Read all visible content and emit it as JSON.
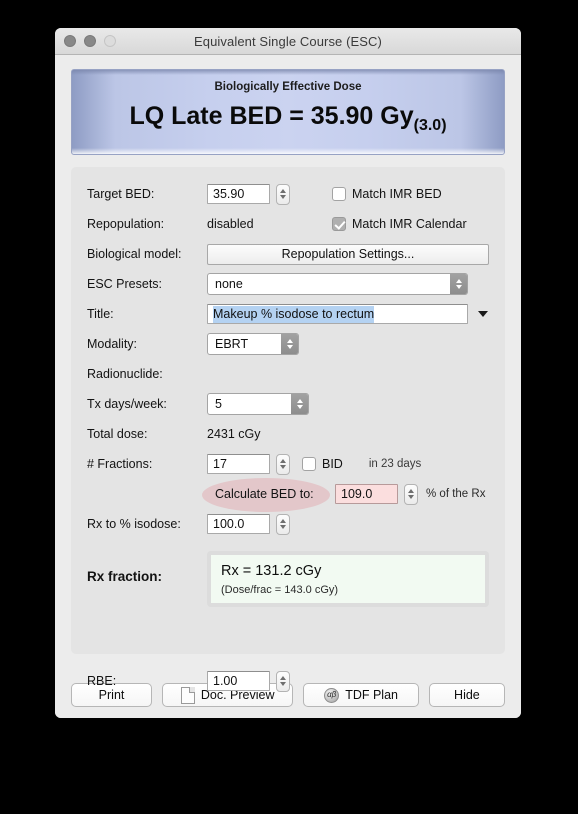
{
  "window": {
    "title": "Equivalent Single Course (ESC)",
    "traffic_lights": [
      "close-button",
      "minimize-button",
      "zoom-button"
    ]
  },
  "banner": {
    "subtitle": "Biologically Effective Dose",
    "main": "LQ Late BED = 35.90 Gy",
    "main_subscript": "(3.0)"
  },
  "form": {
    "target_bed": {
      "label": "Target BED:",
      "value": "35.90"
    },
    "match_imr_bed": {
      "label": "Match IMR BED",
      "checked": false
    },
    "repopulation": {
      "label": "Repopulation:",
      "value": "disabled"
    },
    "match_imr_calendar": {
      "label": "Match IMR Calendar",
      "checked": true
    },
    "biological_model": {
      "label": "Biological model:",
      "button": "Repopulation Settings..."
    },
    "esc_presets": {
      "label": "ESC Presets:",
      "value": "none"
    },
    "title": {
      "label": "Title:",
      "value": "Makeup % isodose to rectum"
    },
    "modality": {
      "label": "Modality:",
      "value": "EBRT"
    },
    "radionuclide": {
      "label": "Radionuclide:",
      "value": ""
    },
    "tx_days_week": {
      "label": "Tx days/week:",
      "value": "5"
    },
    "total_dose": {
      "label": "Total dose:",
      "value": "2431 cGy"
    },
    "fractions": {
      "label": "# Fractions:",
      "value": "17"
    },
    "bid": {
      "label": "BID",
      "checked": false
    },
    "in_days": "in 23 days",
    "calculate_bed_to": {
      "label": "Calculate BED to:",
      "value": "109.0",
      "unit": "% of the Rx",
      "highlighted": true
    },
    "rx_to_isodose": {
      "label": "Rx to % isodose:",
      "value": "100.0"
    },
    "rx_fraction": {
      "label": "Rx fraction:",
      "main": "Rx = 131.2 cGy",
      "sub": "(Dose/frac = 143.0 cGy)"
    },
    "rbe": {
      "label": "RBE:",
      "value": "1.00"
    }
  },
  "footer": {
    "print": "Print",
    "doc_preview": "Doc. Preview",
    "tdf_plan": "TDF Plan",
    "hide": "Hide",
    "tdf_icon_glyph": "αβ"
  },
  "colors": {
    "banner_edge": "#8e9cc4",
    "banner_center": "#cbd3f0",
    "window_bg": "#ececec",
    "panel_bg": "#e4e4e4",
    "highlight_pink": "#e2a0a6",
    "field_pink": "#fbdede",
    "result_bg": "#f2faf2",
    "selection_blue": "#b4d2f2"
  }
}
